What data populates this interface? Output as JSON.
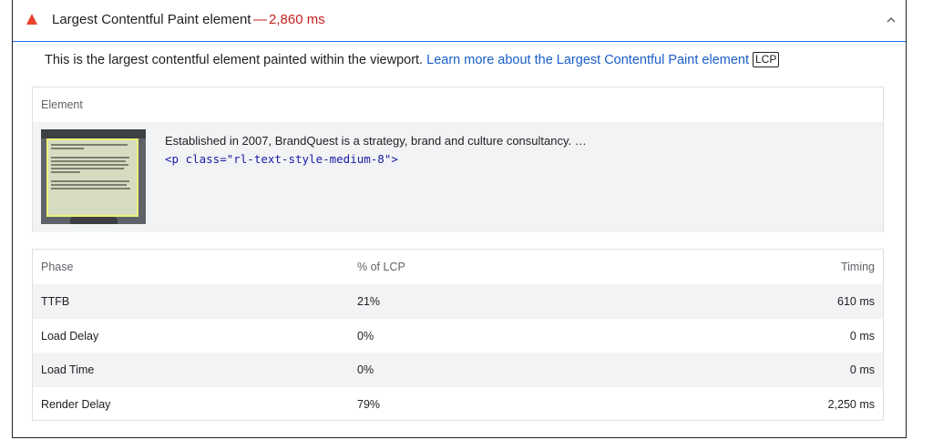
{
  "audit": {
    "title": "Largest Contentful Paint element",
    "separator": "—",
    "value": "2,860 ms",
    "description": "This is the largest contentful element painted within the viewport.",
    "learn_more_link": "Learn more about the Largest Contentful Paint element",
    "badge": "LCP",
    "colors": {
      "warning": "#c5221f",
      "accent": "#1a73e8",
      "link": "#1a5ec9"
    },
    "icons": {
      "status": "warning-triangle-icon",
      "toggle": "chevron-up-icon"
    }
  },
  "element_table": {
    "header": "Element",
    "snippet_text": "Established in 2007, BrandQuest is a strategy, brand and culture consultancy. …",
    "snippet_code": "<p class=\"rl-text-style-medium-8\">"
  },
  "phase_table": {
    "headers": [
      "Phase",
      "% of LCP",
      "Timing"
    ],
    "rows": [
      {
        "phase": "TTFB",
        "percent": "21%",
        "timing": "610 ms"
      },
      {
        "phase": "Load Delay",
        "percent": "0%",
        "timing": "0 ms"
      },
      {
        "phase": "Load Time",
        "percent": "0%",
        "timing": "0 ms"
      },
      {
        "phase": "Render Delay",
        "percent": "79%",
        "timing": "2,250 ms"
      }
    ]
  }
}
